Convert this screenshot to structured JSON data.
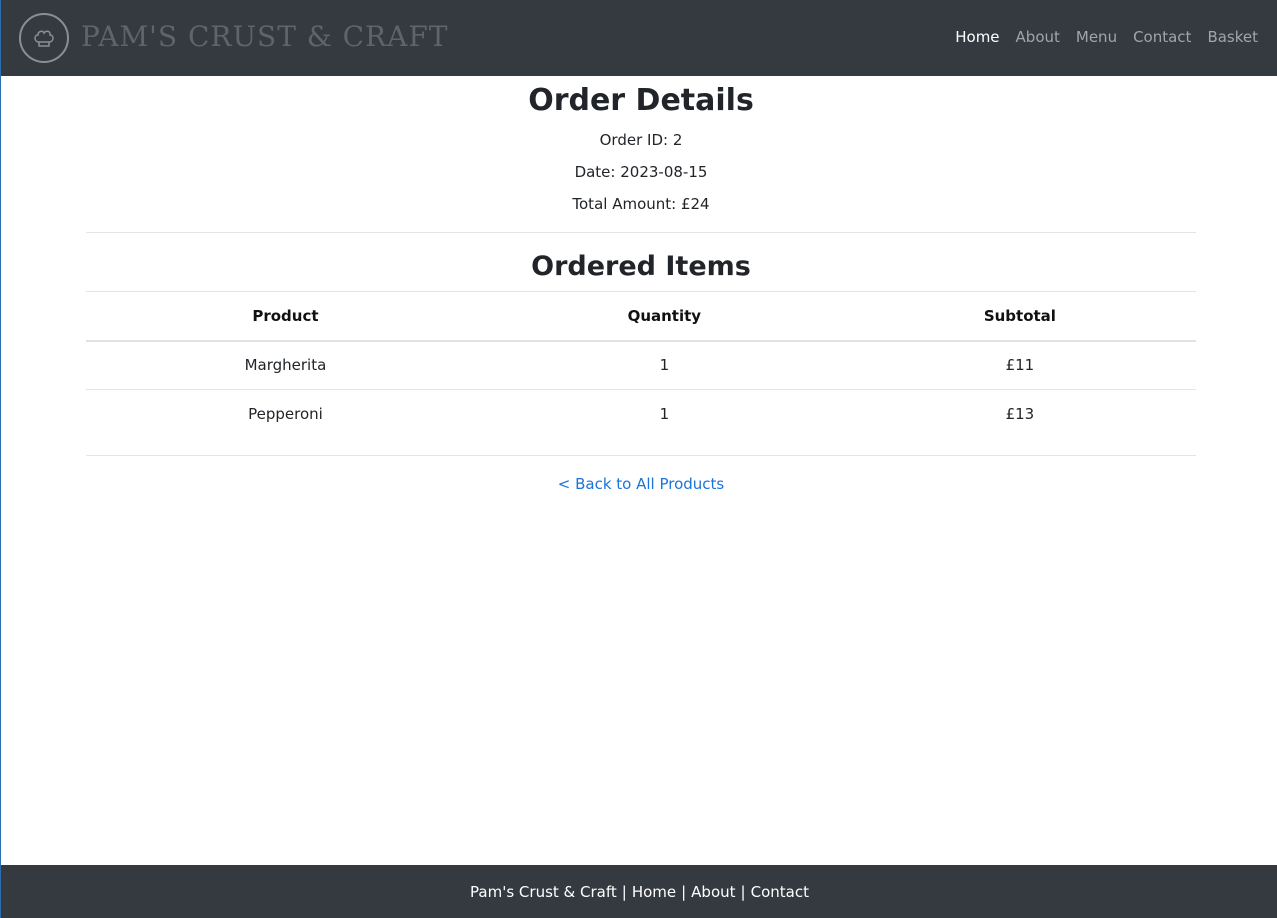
{
  "header": {
    "logo_icon": "chef-hat-icon",
    "brand": "PAM'S CRUST & CRAFT",
    "nav": [
      {
        "label": "Home",
        "active": true
      },
      {
        "label": "About",
        "active": false
      },
      {
        "label": "Menu",
        "active": false
      },
      {
        "label": "Contact",
        "active": false
      },
      {
        "label": "Basket",
        "active": false
      }
    ]
  },
  "order": {
    "title": "Order Details",
    "order_id": "Order ID: 2",
    "date": "Date: 2023-08-15",
    "total": "Total Amount: £24"
  },
  "items": {
    "title": "Ordered Items",
    "columns": [
      "Product",
      "Quantity",
      "Subtotal"
    ],
    "rows": [
      [
        "Margherita",
        "1",
        "£11"
      ],
      [
        "Pepperoni",
        "1",
        "£13"
      ]
    ]
  },
  "back_link": "< Back to All Products",
  "footer": {
    "brand": "Pam's Crust & Craft",
    "links": [
      "Home",
      "About",
      "Contact"
    ],
    "separator": "|"
  },
  "colors": {
    "navbar_bg": "#343a40",
    "link_blue": "#1a73d9"
  }
}
